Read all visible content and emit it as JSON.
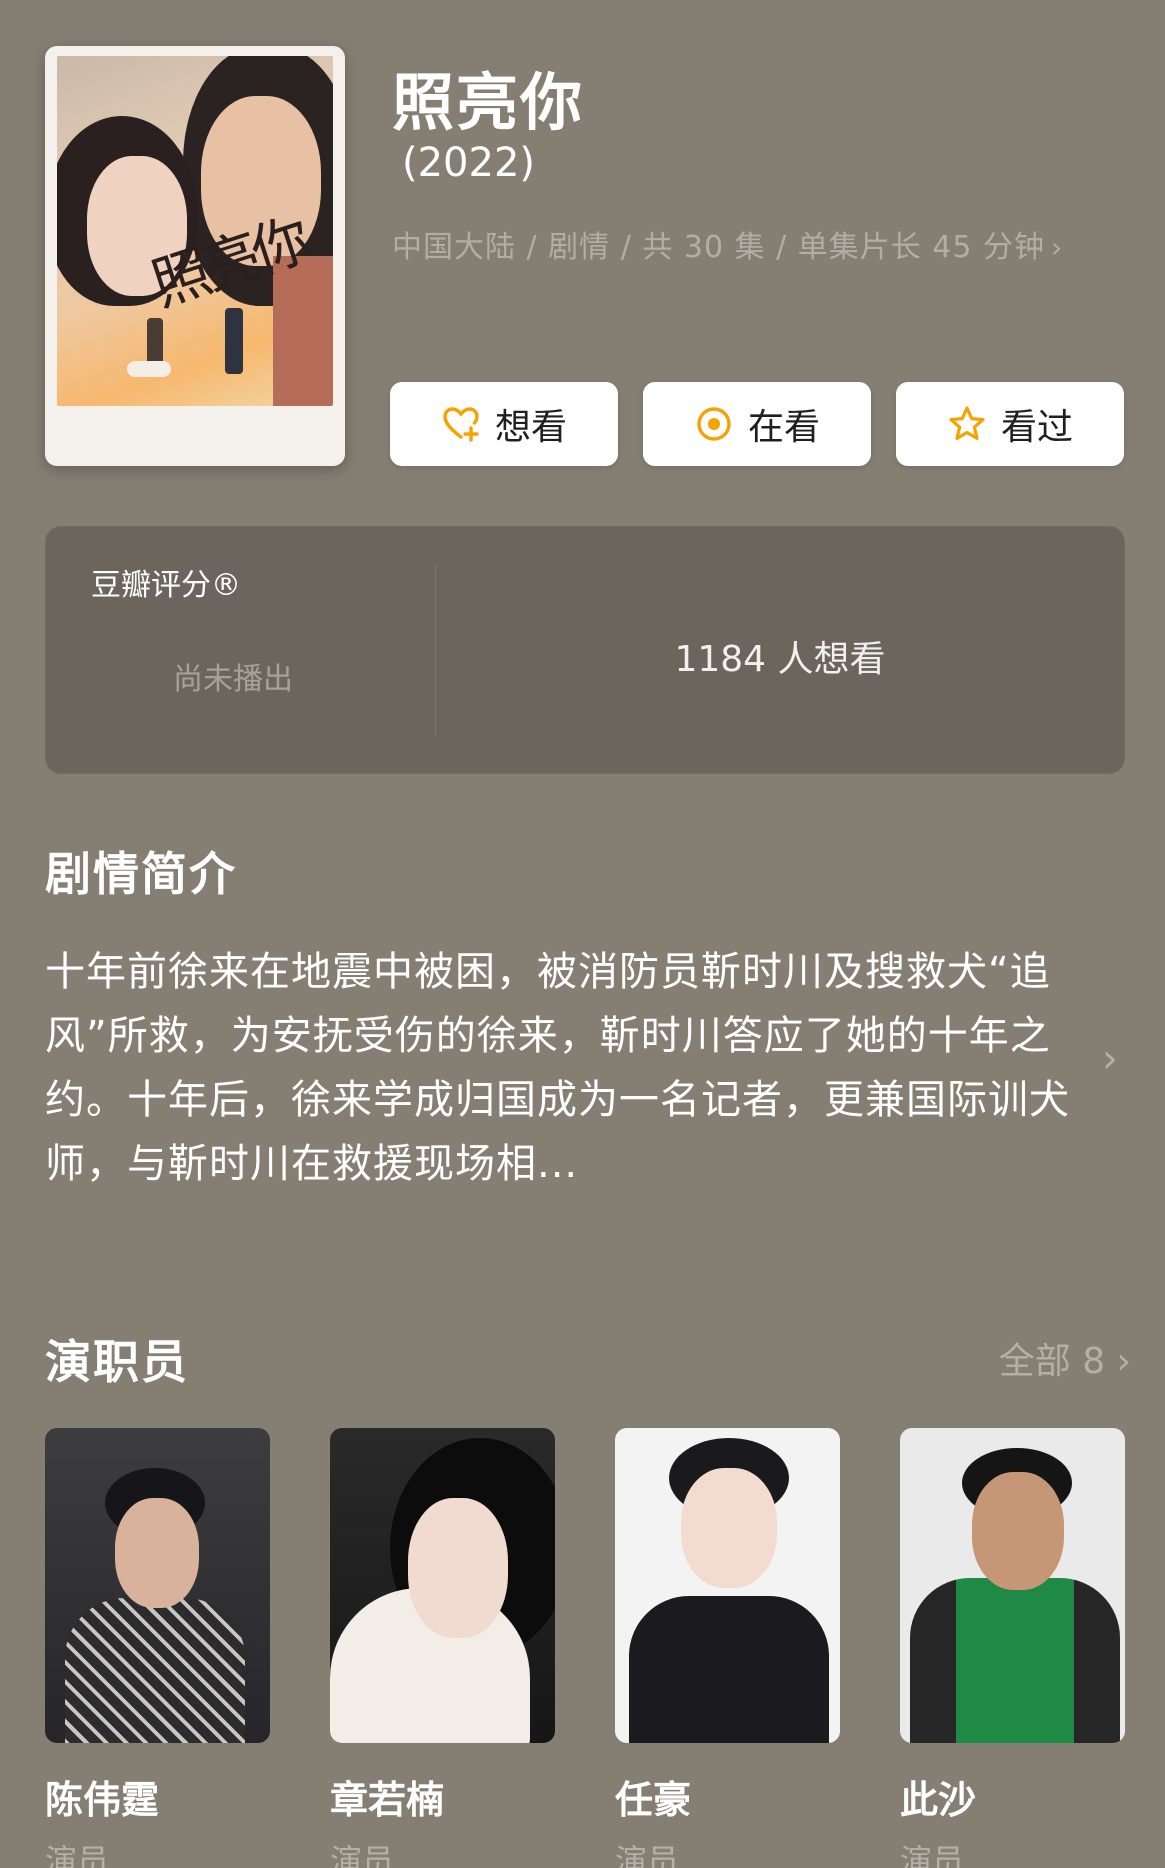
{
  "movie": {
    "title": "照亮你",
    "year": "(2022)",
    "meta": "中国大陆 / 剧情 / 共 30 集 / 单集片长 45 分钟",
    "poster_title": "照亮你"
  },
  "actions": {
    "want_label": "想看",
    "watching_label": "在看",
    "watched_label": "看过"
  },
  "rating": {
    "label": "豆瓣评分®",
    "status": "尚未播出",
    "want_count": "1184 人想看"
  },
  "synopsis": {
    "title": "剧情简介",
    "text": "十年前徐来在地震中被困，被消防员靳时川及搜救犬“追风”所救，为安抚受伤的徐来，靳时川答应了她的十年之约。十年后，徐来学成归国成为一名记者，更兼国际训犬师，与靳时川在救援现场相..."
  },
  "cast": {
    "title": "演职员",
    "all_label": "全部 8",
    "members": [
      {
        "name": "陈伟霆",
        "role": "演员"
      },
      {
        "name": "章若楠",
        "role": "演员"
      },
      {
        "name": "任豪",
        "role": "演员"
      },
      {
        "name": "此沙",
        "role": "演员"
      }
    ]
  },
  "colors": {
    "background": "#857e73",
    "panel": "#6b655d",
    "accent_orange": "#f5a300",
    "muted_text": "#b3ada4"
  },
  "icons": {
    "want": "heart-plus-icon",
    "watching": "target-circle-icon",
    "watched": "star-icon",
    "chevron": "chevron-right-icon"
  }
}
